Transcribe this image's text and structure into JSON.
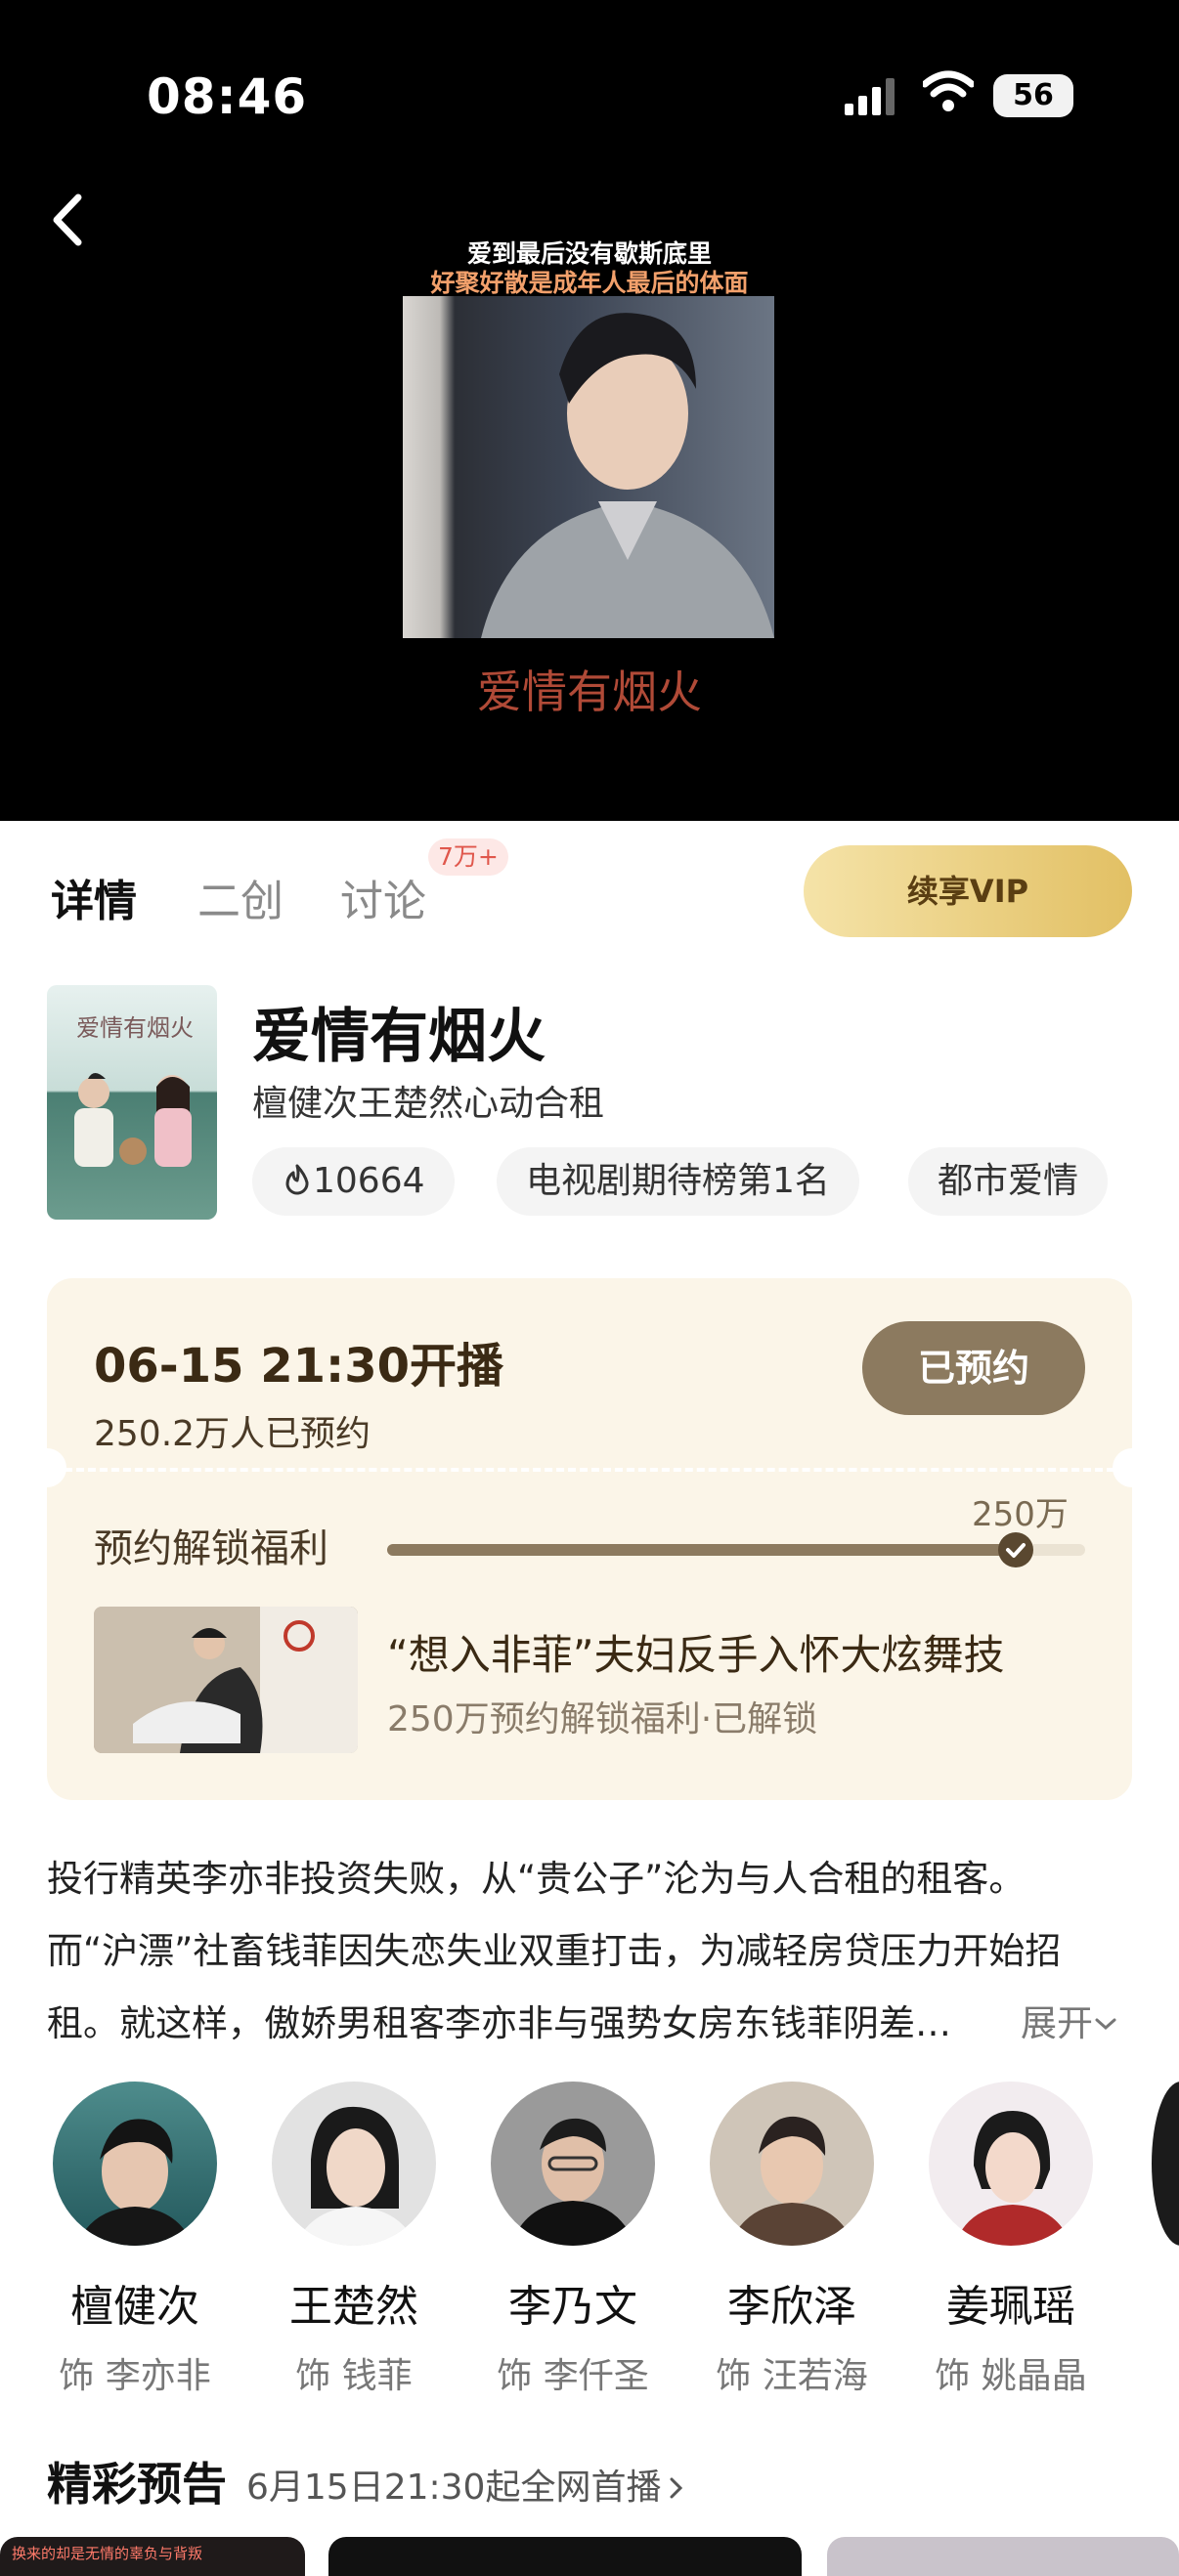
{
  "status_bar": {
    "time": "08:46",
    "battery": "56",
    "icons": [
      "signal-icon",
      "wifi-icon",
      "battery-icon"
    ]
  },
  "player": {
    "back_icon": "chevron-left-icon",
    "poster_line1": "爱到最后没有歇斯底里",
    "poster_line2": "好聚好散是成年人最后的体面",
    "poster_title": "爱情有烟火"
  },
  "tabs": [
    {
      "label": "详情",
      "active": true
    },
    {
      "label": "二创",
      "active": false
    },
    {
      "label": "讨论",
      "active": false,
      "badge": "7万+"
    }
  ],
  "vip_button": "续享VIP",
  "show": {
    "title": "爱情有烟火",
    "subtitle": "檀健次王楚然心动合租",
    "tags": [
      {
        "icon": "flame-icon",
        "label": "10664"
      },
      {
        "label": "电视剧期待榜第1名"
      },
      {
        "label": "都市爱情"
      }
    ]
  },
  "reservation": {
    "release_time": "06-15 21:30开播",
    "reserved_count": "250.2万人已预约",
    "button": "已预约",
    "benefit_label": "预约解锁福利",
    "progress_target": "250万",
    "progress_fraction": 0.9,
    "benefit_title": "“想入非菲”夫妇反手入怀大炫舞技",
    "benefit_status": "250万预约解锁福利·已解锁"
  },
  "synopsis": {
    "line1": "投行精英李亦非投资失败，从“贵公子”沦为与人合租的租客。",
    "line2": "而“沪漂”社畜钱菲因失恋失业双重打击，为减轻房贷压力开始招",
    "line3": "租。就这样，傲娇男租客李亦非与强势女房东钱菲阴差…",
    "expand": "展开"
  },
  "cast": [
    {
      "name": "檀健次",
      "role": "饰 李亦非"
    },
    {
      "name": "王楚然",
      "role": "饰 钱菲"
    },
    {
      "name": "李乃文",
      "role": "饰 李仟圣"
    },
    {
      "name": "李欣泽",
      "role": "饰 汪若海"
    },
    {
      "name": "姜珮瑶",
      "role": "饰 姚晶晶"
    }
  ],
  "trailers": {
    "title": "精彩预告",
    "subtitle": "6月15日21:30起全网首播",
    "card_captions": [
      "换来的却是无情的辜负与背叛",
      "",
      ""
    ]
  },
  "colors": {
    "accent_gold": "#e2c064",
    "reserved_brown": "#8c7a5f",
    "card_bg": "#fbf5e8"
  }
}
